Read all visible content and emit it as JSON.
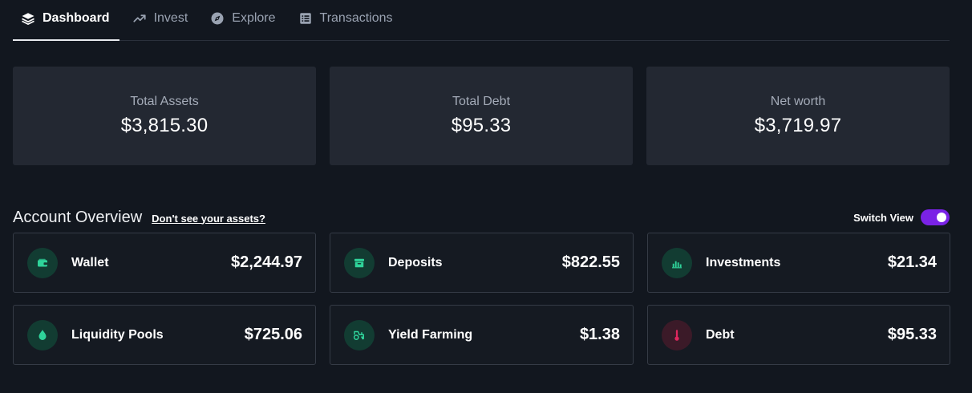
{
  "tabs": [
    {
      "label": "Dashboard",
      "icon": "layers-icon",
      "active": true
    },
    {
      "label": "Invest",
      "icon": "trend-up-icon",
      "active": false
    },
    {
      "label": "Explore",
      "icon": "compass-icon",
      "active": false
    },
    {
      "label": "Transactions",
      "icon": "list-icon",
      "active": false
    }
  ],
  "summary": [
    {
      "label": "Total Assets",
      "value": "$3,815.30"
    },
    {
      "label": "Total Debt",
      "value": "$95.33"
    },
    {
      "label": "Net worth",
      "value": "$3,719.97"
    }
  ],
  "overview": {
    "title": "Account Overview",
    "link": "Don't see your assets?",
    "switch_label": "Switch View",
    "switch_on": true
  },
  "accounts": [
    {
      "name": "Wallet",
      "value": "$2,244.97",
      "icon": "wallet-icon",
      "tone": "green"
    },
    {
      "name": "Deposits",
      "value": "$822.55",
      "icon": "archive-box-icon",
      "tone": "green"
    },
    {
      "name": "Investments",
      "value": "$21.34",
      "icon": "bar-chart-icon",
      "tone": "green"
    },
    {
      "name": "Liquidity Pools",
      "value": "$725.06",
      "icon": "droplet-icon",
      "tone": "green"
    },
    {
      "name": "Yield Farming",
      "value": "$1.38",
      "icon": "tractor-icon",
      "tone": "green"
    },
    {
      "name": "Debt",
      "value": "$95.33",
      "icon": "thermometer-icon",
      "tone": "red"
    }
  ],
  "colors": {
    "background": "#12171f",
    "card": "#232832",
    "accent_green": "#2fd39a",
    "accent_red": "#e2275f",
    "switch": "#7a22e6"
  }
}
